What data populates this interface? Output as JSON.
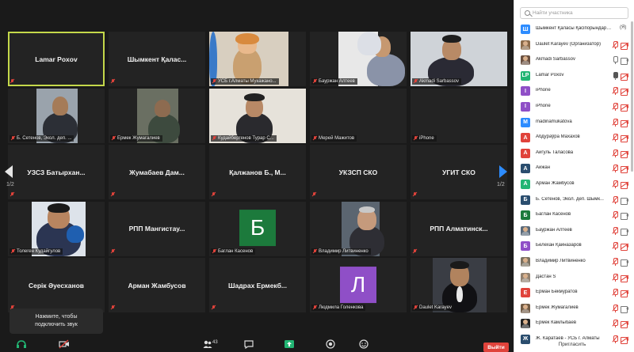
{
  "gallery": {
    "page_left": "1/2",
    "page_right": "1/2",
    "tiles": [
      {
        "type": "name",
        "text": "Lamar Poxov",
        "active": true
      },
      {
        "type": "name",
        "text": "Шымкент Қалас..."
      },
      {
        "type": "video",
        "label": "УСБ г.Алматы Мукажано..."
      },
      {
        "type": "video",
        "label": "Бауржан Алтеев"
      },
      {
        "type": "video",
        "label": "Akmadi Sarbassov"
      },
      {
        "type": "video",
        "label": "Б. Сетенов, Экол. деп. ..."
      },
      {
        "type": "video",
        "label": "Ермек Жумагалиев"
      },
      {
        "type": "video",
        "label": "Кудайбергенов Турар С..."
      },
      {
        "type": "label_only",
        "label": "Мерей Мажитов"
      },
      {
        "type": "label_only",
        "label": "iPhone"
      },
      {
        "type": "name",
        "text": "УЗСЗ Батырхан..."
      },
      {
        "type": "name",
        "text": "Жумабаев Дам..."
      },
      {
        "type": "name",
        "text": "Қалжанов Б., М..."
      },
      {
        "type": "name",
        "text": "УКЗСП СКО"
      },
      {
        "type": "name",
        "text": "УГИТ СКО"
      },
      {
        "type": "video",
        "label": "Толеген Кудайгулов"
      },
      {
        "type": "name",
        "text": "РПП Мангистау..."
      },
      {
        "type": "letter",
        "letter": "Б",
        "label": "Баглан Касенов"
      },
      {
        "type": "video",
        "label": "Владимир Литвиненко"
      },
      {
        "type": "name",
        "text": "РПП Алматинск..."
      },
      {
        "type": "name",
        "text": "Серік Әуесханов"
      },
      {
        "type": "name",
        "text": "Арман Жамбусов"
      },
      {
        "type": "name",
        "text": "Шадрах Ермекб..."
      },
      {
        "type": "letter",
        "letter": "Л",
        "label": "Людмила Голенкова"
      },
      {
        "type": "video",
        "label": "Daulet Karayev"
      }
    ],
    "colors": {
      "active_outline": "#c4d84a",
      "letter_green": "#1c7a3c",
      "letter_purple": "#8f4fc7"
    }
  },
  "tooltip": {
    "line1": "Нажмите, чтобы",
    "line2": "подключить звук"
  },
  "toolbar": {
    "participants_count": "43",
    "leave_label": "Выйти"
  },
  "panel": {
    "search_placeholder": "Найти участника",
    "invite_label": "Пригласить",
    "participants": [
      {
        "avatar": "Ш",
        "color": "#2d8cff",
        "name": "Шымкент Қаласы Қасіпорындар Ор...",
        "tag": "(Я)"
      },
      {
        "avatar": "photo",
        "color": "#8a6a4a",
        "name": "Daulet Karayev (Организатор)",
        "mic": "off",
        "cam": "off"
      },
      {
        "avatar": "photo",
        "color": "#6a5040",
        "name": "Akmadi Sarbassov",
        "mic": "muted-gray",
        "cam": "on"
      },
      {
        "avatar": "LP",
        "color": "#22b573",
        "name": "Lamar Poxov",
        "mic": "on",
        "cam": "off"
      },
      {
        "avatar": "I",
        "color": "#8f4fc7",
        "name": "iPhone",
        "mic": "off",
        "cam": "off"
      },
      {
        "avatar": "I",
        "color": "#8f4fc7",
        "name": "iPhone",
        "mic": "off",
        "cam": "off"
      },
      {
        "avatar": "M",
        "color": "#2d8cff",
        "name": "madinamukatova",
        "mic": "off",
        "cam": "off"
      },
      {
        "avatar": "А",
        "color": "#e0433b",
        "name": "Абдураўра Махахов",
        "mic": "off",
        "cam": "off"
      },
      {
        "avatar": "А",
        "color": "#e0433b",
        "name": "Айгуль Таласова",
        "mic": "off",
        "cam": "off"
      },
      {
        "avatar": "А",
        "color": "#2a4d6e",
        "name": "Айжан",
        "mic": "off",
        "cam": "off"
      },
      {
        "avatar": "А",
        "color": "#22b573",
        "name": "Арман Жамбусов",
        "mic": "off",
        "cam": "off"
      },
      {
        "avatar": "Б",
        "color": "#2a4d6e",
        "name": "Б. Сетенов, Экол. деп. Шымк...",
        "mic": "off",
        "cam": "on"
      },
      {
        "avatar": "Б",
        "color": "#1c7a3c",
        "name": "Баглан Касенов",
        "mic": "off",
        "cam": "on"
      },
      {
        "avatar": "photo",
        "color": "#5a6a7a",
        "name": "Бауржан Алтеев",
        "mic": "off",
        "cam": "on"
      },
      {
        "avatar": "Б",
        "color": "#8f4fc7",
        "name": "Белехан Қайназаров",
        "mic": "off",
        "cam": "off"
      },
      {
        "avatar": "photo",
        "color": "#7a7060",
        "name": "Владимир Литвиненко",
        "mic": "off",
        "cam": "on"
      },
      {
        "avatar": "photo",
        "color": "#908070",
        "name": "Дастан S",
        "mic": "off",
        "cam": "off"
      },
      {
        "avatar": "Е",
        "color": "#e0433b",
        "name": "Ерман Бекмуратов",
        "mic": "off",
        "cam": "off"
      },
      {
        "avatar": "photo",
        "color": "#705a45",
        "name": "Ермек Жумагалиев",
        "mic": "off",
        "cam": "on"
      },
      {
        "avatar": "photo",
        "color": "#222222",
        "name": "Ермек Камлыбаев",
        "mic": "off",
        "cam": "off"
      },
      {
        "avatar": "Ж",
        "color": "#2a4d6e",
        "name": "Ж. Каратаев - УСБ г. Алматы",
        "mic": "off",
        "cam": "off"
      }
    ]
  }
}
